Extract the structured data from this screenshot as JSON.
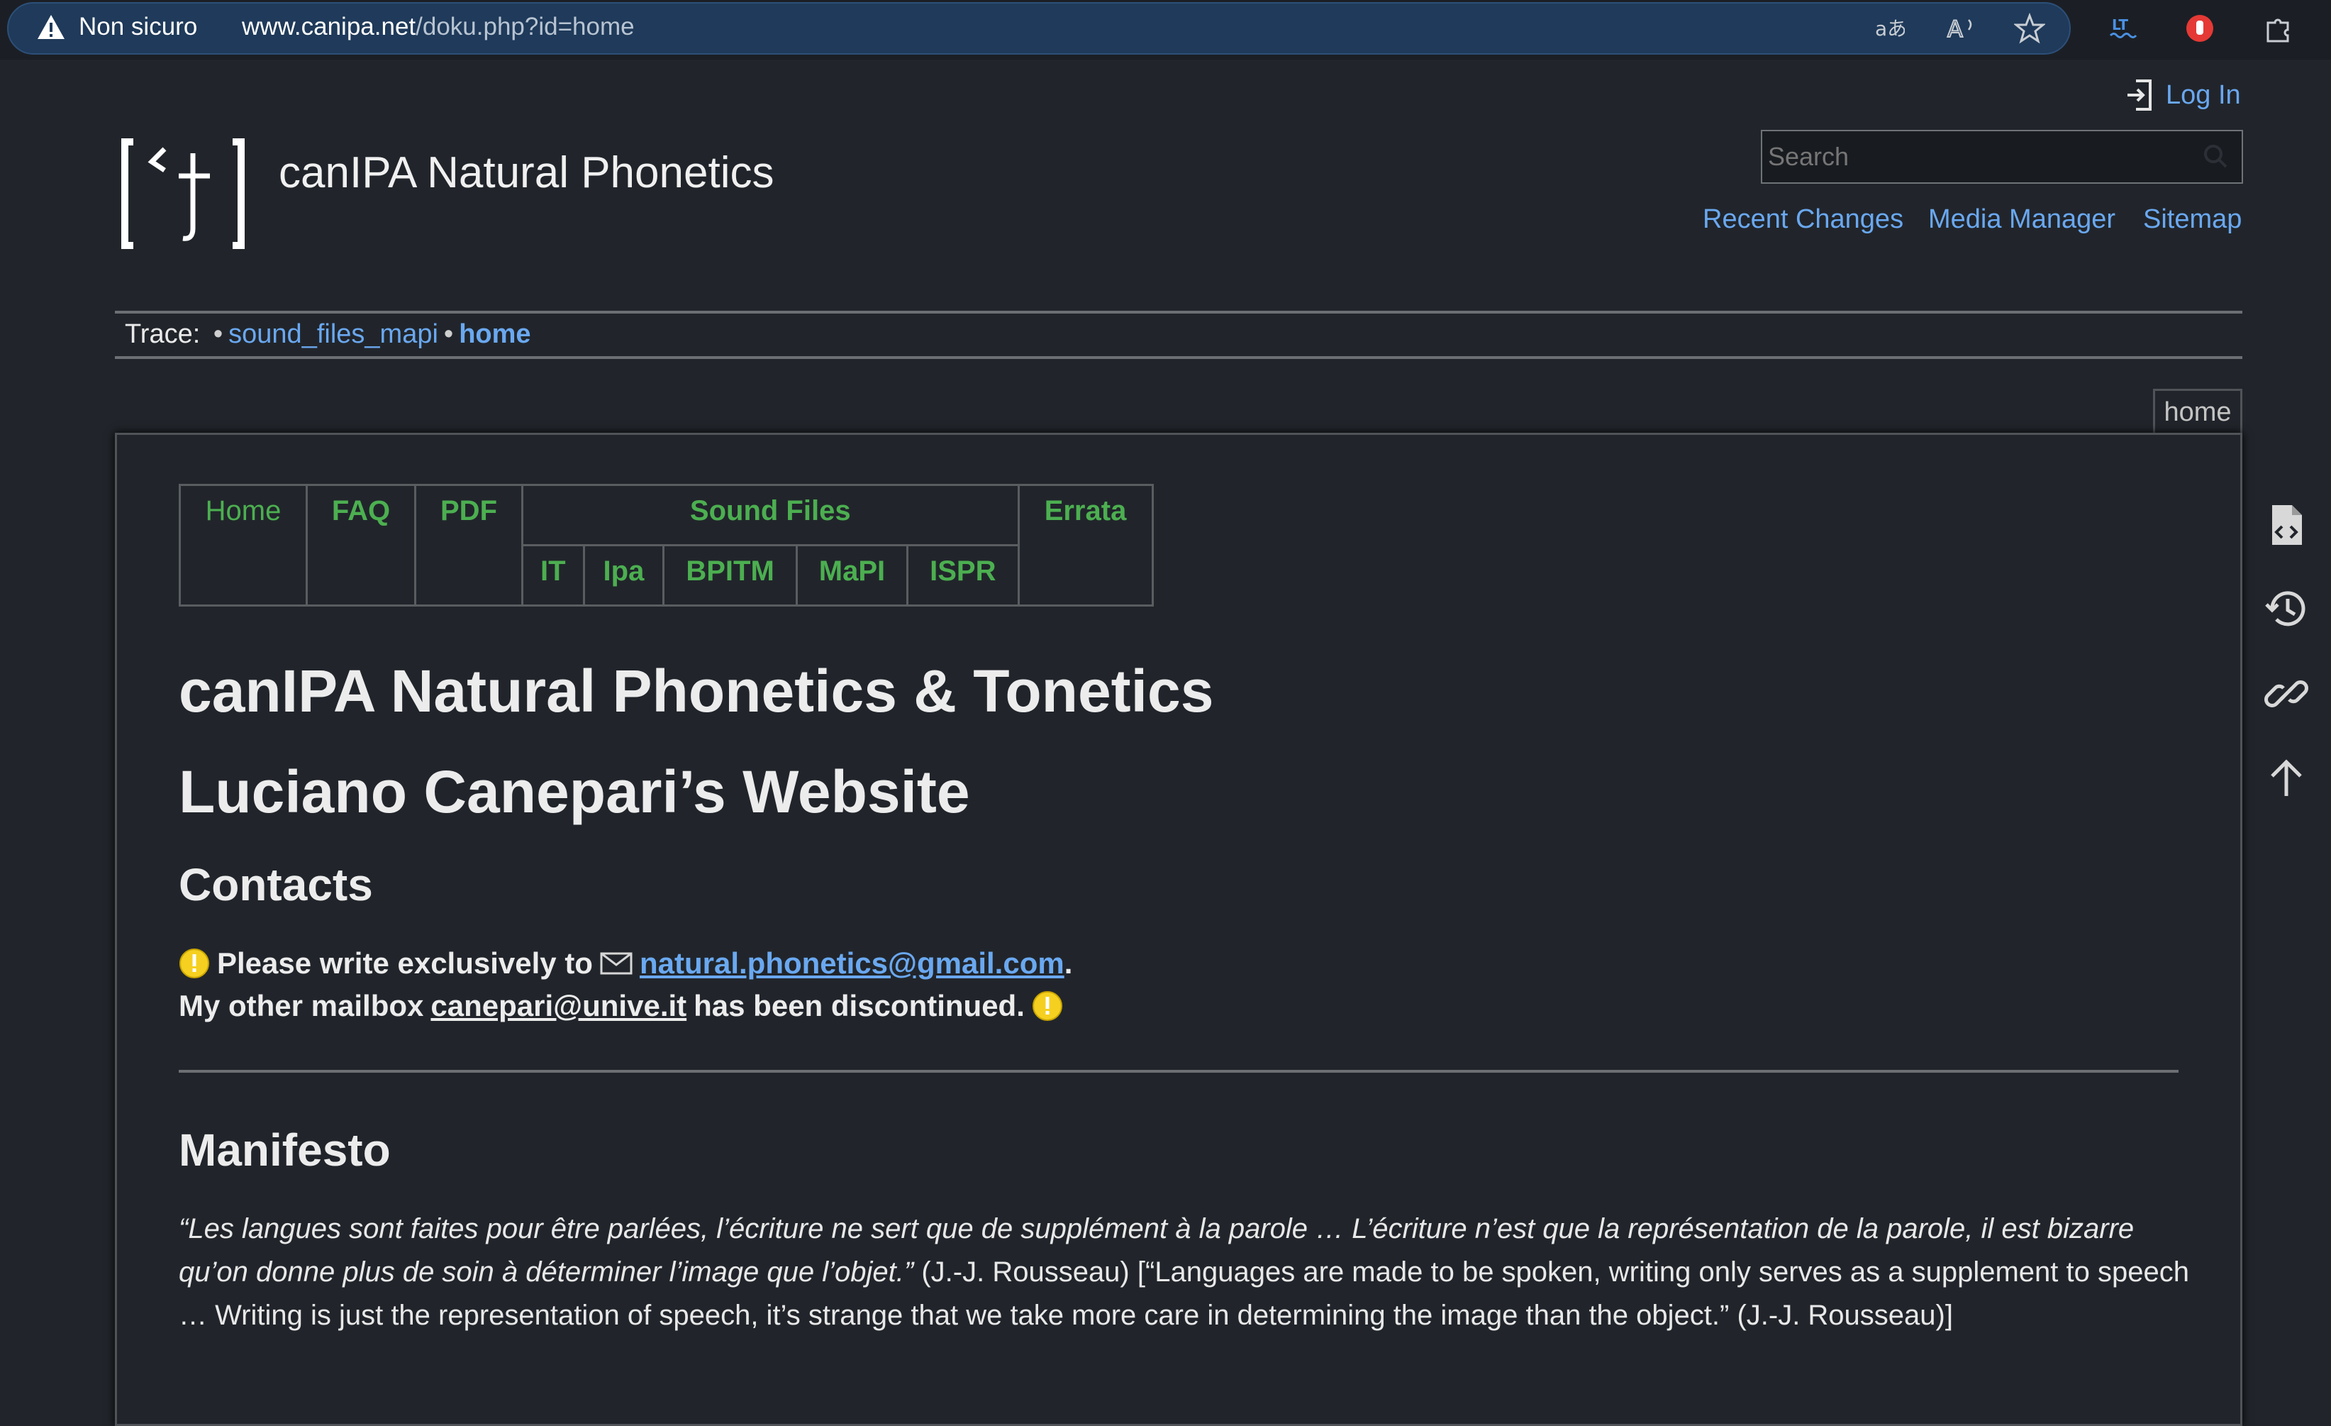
{
  "browser": {
    "security_label": "Non sicuro",
    "url_host": "www.canipa.net",
    "url_path": "/doku.php?id=home",
    "toolbar_icons": [
      "translate-icon",
      "read-aloud-icon",
      "favorite-star-icon",
      "extension-icon",
      "adblock-icon",
      "extensions-puzzle-icon"
    ]
  },
  "header": {
    "login_label": "Log In",
    "site_title": "canIPA Natural Phonetics",
    "search_placeholder": "Search",
    "tools": [
      "Recent Changes",
      "Media Manager",
      "Sitemap"
    ]
  },
  "trace": {
    "label": "Trace:",
    "items": [
      "sound_files_mapi",
      "home"
    ]
  },
  "page_tab": "home",
  "nav": {
    "home": "Home",
    "faq": "FAQ",
    "pdf": "PDF",
    "sound_files": "Sound Files",
    "errata": "Errata",
    "sub": [
      "IT",
      "Ipa",
      "BPITM",
      "MaPI",
      "ISPR"
    ]
  },
  "content": {
    "title1": "canIPA Natural Phonetics & Tonetics",
    "title2": "Luciano Canepari’s Website",
    "contacts_heading": "Contacts",
    "line1_prefix": "Please write exclusively to",
    "email1": "natural.phonetics@gmail.com",
    "line1_suffix": ".",
    "line2_prefix": "My other mailbox",
    "email2": "canepari@unive.it",
    "line2_suffix": "has been discontinued.",
    "manifesto_heading": "Manifesto",
    "manifesto_quote": "“Les langues sont faites pour être parlées, l’écriture ne sert que de supplément à la parole … L’écriture n’est que la représentation de la parole, il est bizarre qu’on donne plus de soin à déterminer l’image que l’objet.”",
    "manifesto_rest": " (J.-J. Rousseau) [“Languages are made to be spoken, writing only serves as a supplement to speech … Writing is just the representation of speech, it’s strange that we take more care in determining the image than the object.” (J.-J. Rousseau)]"
  },
  "colors": {
    "background": "#21252b",
    "link": "#6aa8f0",
    "nav_green": "#4caf50",
    "url_bar": "#1f3a5a"
  }
}
